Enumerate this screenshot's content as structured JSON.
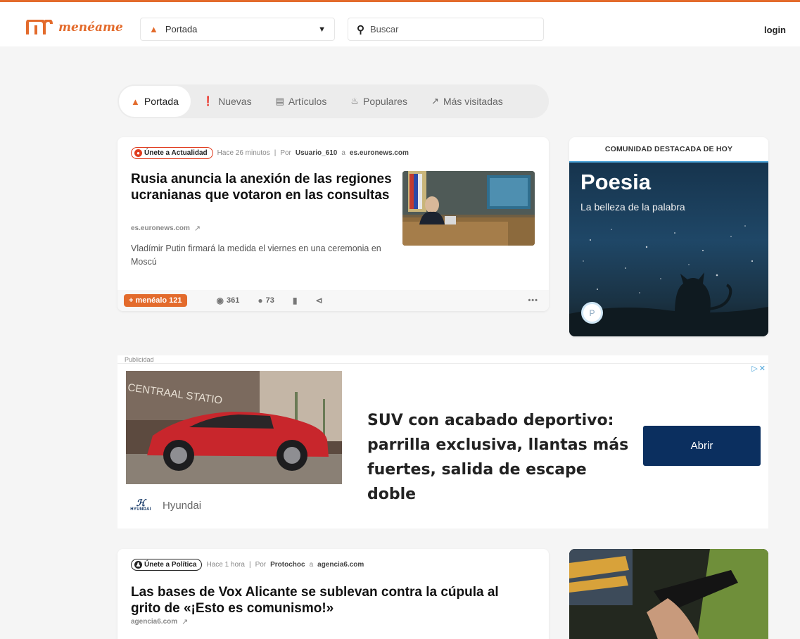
{
  "header": {
    "brand": "menéame",
    "section": "Portada",
    "search_placeholder": "Buscar",
    "login": "login"
  },
  "tabs": [
    {
      "label": "Portada",
      "icon": "home-icon",
      "active": true
    },
    {
      "label": "Nuevas",
      "icon": "alert-circle-icon"
    },
    {
      "label": "Artículos",
      "icon": "document-icon"
    },
    {
      "label": "Populares",
      "icon": "flame-icon"
    },
    {
      "label": "Más visitadas",
      "icon": "trend-arrow-icon"
    }
  ],
  "story1": {
    "join_label": "Únete a Actualidad",
    "time": "Hace 26 minutos",
    "por": "Por",
    "user": "Usuario_610",
    "a": "a",
    "domain": "es.euronews.com",
    "headline": "Rusia anuncia la anexión de las regiones ucranianas que votaron en las consultas",
    "source": "es.euronews.com",
    "summary": "Vladímir Putin firmará la medida el viernes en una ceremonia en Moscú",
    "meneo": "+ menéalo 121",
    "views": "361",
    "comments": "73",
    "more": "•••"
  },
  "community": {
    "header": "COMUNIDAD DESTACADA DE HOY",
    "name": "Poesia",
    "description": "La belleza de la palabra",
    "avatar_letter": "P"
  },
  "ad": {
    "label": "Publicidad",
    "headline": "SUV con acabado deportivo: parrilla exclusiva, llantas más fuertes, salida de escape doble",
    "button": "Abrir",
    "brand": "Hyundai",
    "logo_text": "HYUNDAI",
    "image_sign": "CENTRAAL STATIO"
  },
  "story2": {
    "join_label": "Únete a Política",
    "time": "Hace 1 hora",
    "por": "Por",
    "user": "Protochoc",
    "a": "a",
    "domain": "agencia6.com",
    "headline": "Las bases de Vox Alicante se sublevan contra la cúpula al grito de «¡Esto es comunismo!»",
    "source": "agencia6.com"
  },
  "colors": {
    "brand": "#e36b2c",
    "ad_button": "#0b2f5f",
    "join_border": "#e03c1e"
  }
}
